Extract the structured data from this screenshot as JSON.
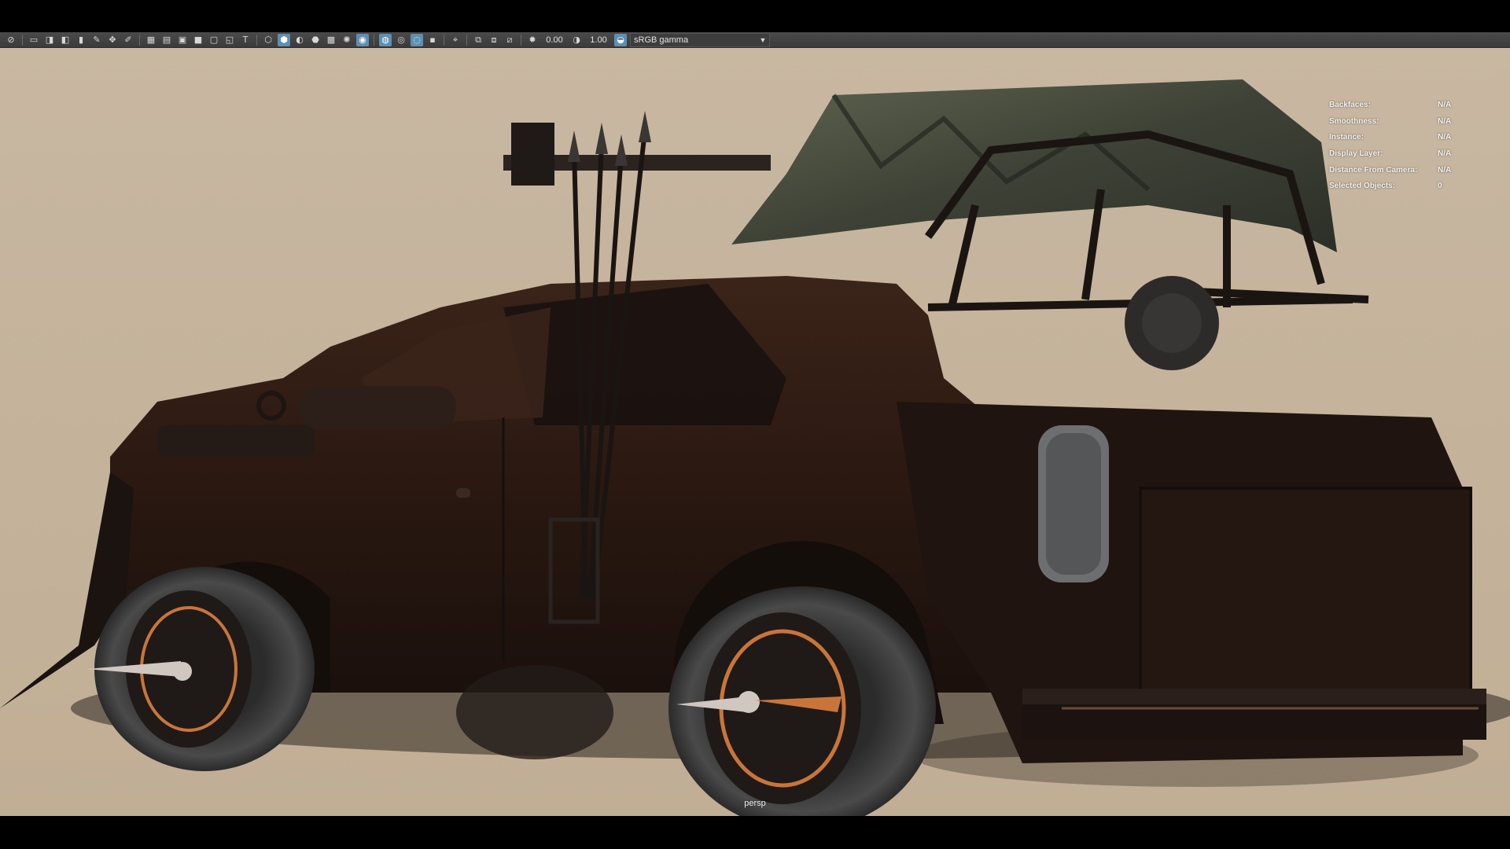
{
  "toolbar": {
    "icons": [
      "select-camera-icon",
      "camera-attributes-icon",
      "bookmark-icon",
      "image-plane-icon",
      "grid-icon",
      "film-gate-icon",
      "resolution-gate-icon",
      "safe-action-icon",
      "wireframe-icon",
      "smooth-shade-icon",
      "texture-icon",
      "lighting-icon",
      "shadows-icon",
      "ambient-occlusion-icon",
      "isolate-select-icon",
      "xray-icon",
      "xray-joints-icon",
      "backface-icon"
    ],
    "exposure_value": "0.00",
    "gamma_value": "1.00",
    "color_space": "sRGB gamma"
  },
  "hud": [
    {
      "label": "Backfaces:",
      "value": "N/A"
    },
    {
      "label": "Smoothness:",
      "value": "N/A"
    },
    {
      "label": "Instance:",
      "value": "N/A"
    },
    {
      "label": "Display Layer:",
      "value": "N/A"
    },
    {
      "label": "Distance From Camera:",
      "value": "N/A"
    },
    {
      "label": "Selected Objects:",
      "value": "0"
    }
  ],
  "viewport": {
    "camera_name": "persp",
    "background_color": "#c5b39c"
  },
  "colors": {
    "accent": "#5d8fb3",
    "vehicle_body": "#2a1a14",
    "canopy": "#4d5240"
  }
}
